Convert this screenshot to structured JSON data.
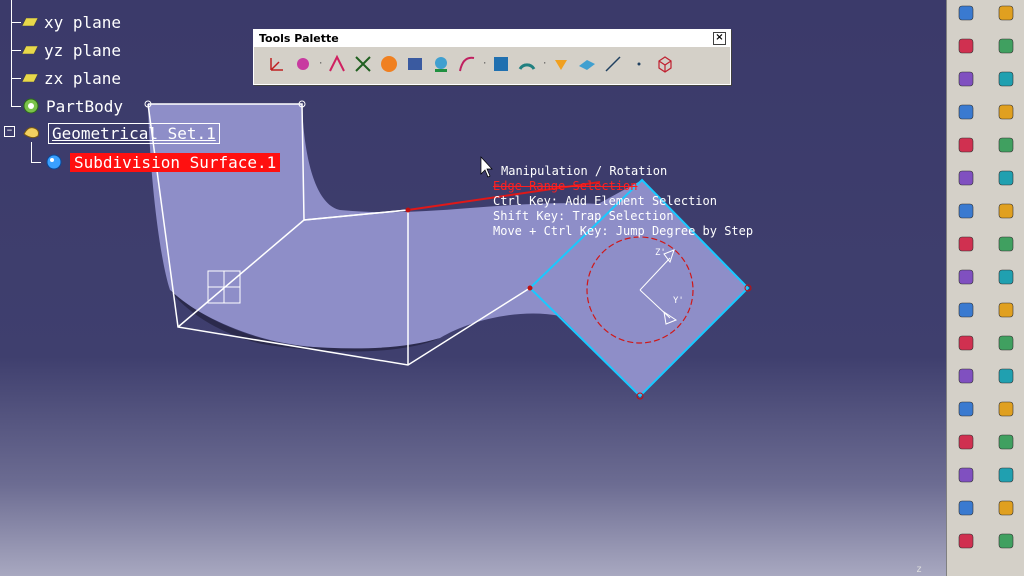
{
  "tree": {
    "items": [
      {
        "label": "xy plane",
        "icon": "plane-icon"
      },
      {
        "label": "yz plane",
        "icon": "plane-icon"
      },
      {
        "label": "zx plane",
        "icon": "plane-icon"
      },
      {
        "label": "PartBody",
        "icon": "partbody-gear-icon"
      },
      {
        "label": "Geometrical Set.1",
        "icon": "geometrical-set-icon"
      },
      {
        "label": "Subdivision Surface.1",
        "icon": "subdivision-surface-icon"
      }
    ]
  },
  "tools_palette": {
    "title": "Tools Palette",
    "close_label": "×",
    "icons": [
      "axis-system-icon",
      "point-cloud-icon",
      "manipulator-icon",
      "compass-icon",
      "color-map-icon",
      "cube-shade-icon",
      "sphere-icon",
      "curve-tool-icon",
      "grid-icon",
      "gauge-icon",
      "paint-brush-icon",
      "surface-icon",
      "line-icon",
      "point-icon",
      "box-icon"
    ]
  },
  "tooltip": {
    "lines": [
      "Manipulation / Rotation",
      "Edge Range Selection",
      "Ctrl Key: Add Element Selection",
      "Shift Key: Trap Selection",
      "Move + Ctrl Key: Jump Degree by Step"
    ]
  },
  "manipulator": {
    "axis_z": "Z'",
    "axis_y": "Y'"
  },
  "colors": {
    "surface": "#8e8ec8",
    "highlight_cyan": "#19c9ff",
    "selection_red": "#ff1010",
    "background": "#3b3a6a"
  },
  "right_toolbar_icons": [
    "fork-icon",
    "curve-icon",
    "select-arrow-icon",
    "cube-icon",
    "cube-stack-icon",
    "refine-icon",
    "sweep-icon",
    "axis-xyz-icon",
    "bridge-icon",
    "fillet-icon",
    "curve-blend-icon",
    "shell-icon",
    "rings-icon",
    "mesh-icon",
    "revolve-icon",
    "cylinder-icon",
    "wave-icon",
    "tube-icon",
    "square-icon",
    "merge-icon",
    "lamp-icon",
    "twist-icon",
    "sphere-pair-icon",
    "wrap-icon",
    "knot-icon",
    "grid-dots-icon",
    "stack-icon",
    "wireframe-cube-icon",
    "analysis-icon",
    "tangent-icon",
    "close-cross-icon",
    "eye-icon",
    "settings-icon",
    "lock-icon"
  ],
  "footer": {
    "z_indicator": "z"
  }
}
